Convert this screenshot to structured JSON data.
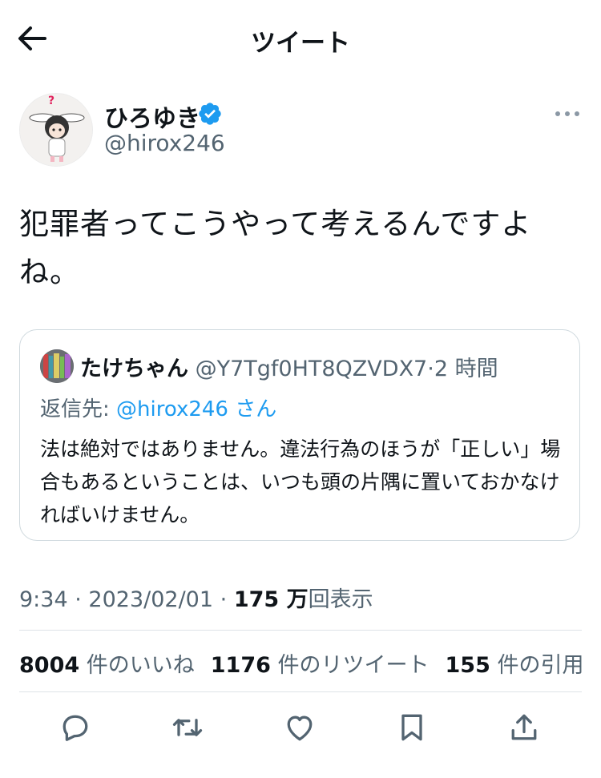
{
  "header": {
    "title": "ツイート",
    "back_icon": "arrow-left-icon"
  },
  "author": {
    "name": "ひろゆき",
    "handle": "@hirox246",
    "verified": true,
    "avatar_question_mark": "?"
  },
  "tweet": {
    "text": "犯罪者ってこうやって考えるんですよね。"
  },
  "quote": {
    "name": "たけちゃん",
    "handle": "@Y7Tgf0HT8QZVDX7",
    "sep": "·",
    "time": "2 時間",
    "reply_prefix": "返信先: ",
    "reply_to": "@hirox246",
    "reply_suffix": " さん",
    "text": "法は絶対ではありません。違法行為のほうが「正しい」場合もあるということは、いつも頭の片隅に置いておかなければいけません。"
  },
  "meta": {
    "time": "9:34",
    "sep1": "·",
    "date": "2023/02/01",
    "sep2": "·",
    "views_count": "175 万",
    "views_label": "回表示"
  },
  "stats": {
    "likes_count": "8004",
    "likes_label": " 件のいいね",
    "retweets_count": "1176",
    "retweets_label": " 件のリツイート",
    "quotes_count": "155",
    "quotes_label": " 件の引用"
  },
  "actions": [
    "reply-icon",
    "retweet-icon",
    "like-icon",
    "bookmark-icon",
    "share-icon"
  ],
  "colors": {
    "text": "#0f1419",
    "secondary": "#536471",
    "link": "#1d9bf0",
    "border": "#cfd9de"
  }
}
